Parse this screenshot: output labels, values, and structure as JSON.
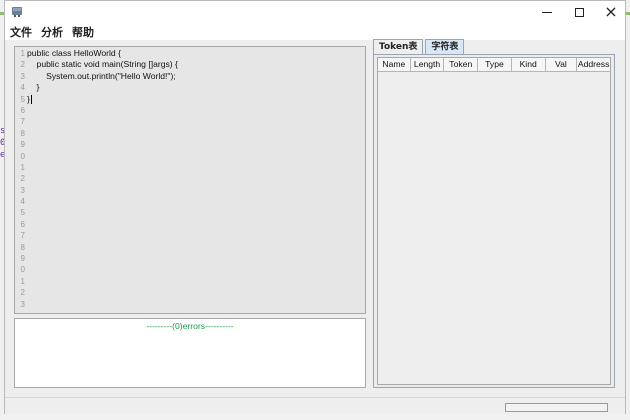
{
  "window": {
    "app_icon": "java-cup-icon",
    "controls": {
      "minimize": "minimize-icon",
      "maximize": "maximize-icon",
      "close": "×"
    }
  },
  "menu": [
    "文件",
    "分析",
    "帮助"
  ],
  "editor": {
    "code_lines": [
      "public class HelloWorld {",
      "    public static void main(String []args) {",
      "        System.out.println(\"Hello World!\");",
      "    }",
      "}"
    ],
    "line_numbers": [
      "1",
      "2",
      "3",
      "4",
      "5",
      "6",
      "7",
      "8",
      "9",
      "0",
      "1",
      "2",
      "3",
      "4",
      "5",
      "6",
      "7",
      "8",
      "9",
      "0",
      "1",
      "2",
      "3"
    ]
  },
  "errors": {
    "message": "---------(0)errors----------",
    "color": "#1b9a45"
  },
  "tabs": [
    {
      "label": "Token表",
      "active": false
    },
    {
      "label": "字符表",
      "active": true
    }
  ],
  "table": {
    "columns": [
      "Name",
      "Length",
      "Token",
      "Type",
      "Kind",
      "Val",
      "Address"
    ]
  },
  "desktop": {
    "left_marks": [
      "s",
      "0",
      "e"
    ]
  }
}
